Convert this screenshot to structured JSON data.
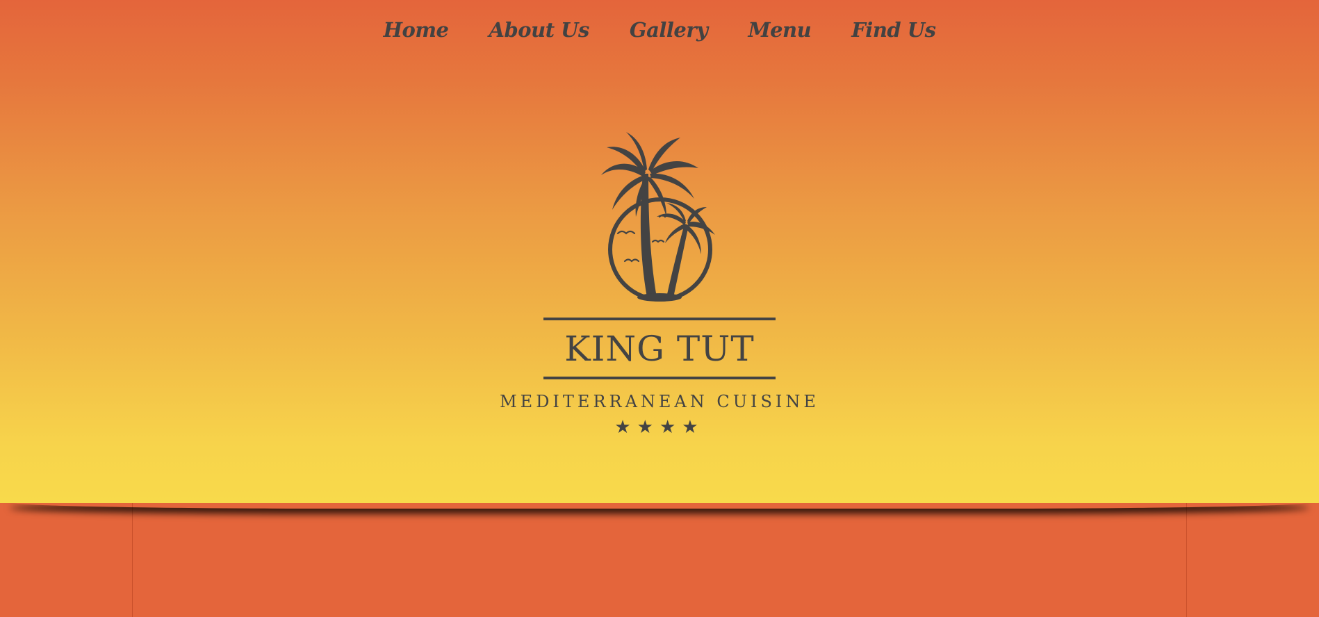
{
  "nav": {
    "items": [
      {
        "label": "Home"
      },
      {
        "label": "About Us"
      },
      {
        "label": "Gallery"
      },
      {
        "label": "Menu"
      },
      {
        "label": "Find Us"
      }
    ]
  },
  "logo": {
    "brand": "KING TUT",
    "tagline": "MEDITERRANEAN CUISINE",
    "stars": "★★★★",
    "rating": 4
  },
  "colors": {
    "gradient_top": "#e4653b",
    "gradient_bottom": "#f8da4b",
    "ink": "#434343",
    "background": "#e4653b"
  }
}
